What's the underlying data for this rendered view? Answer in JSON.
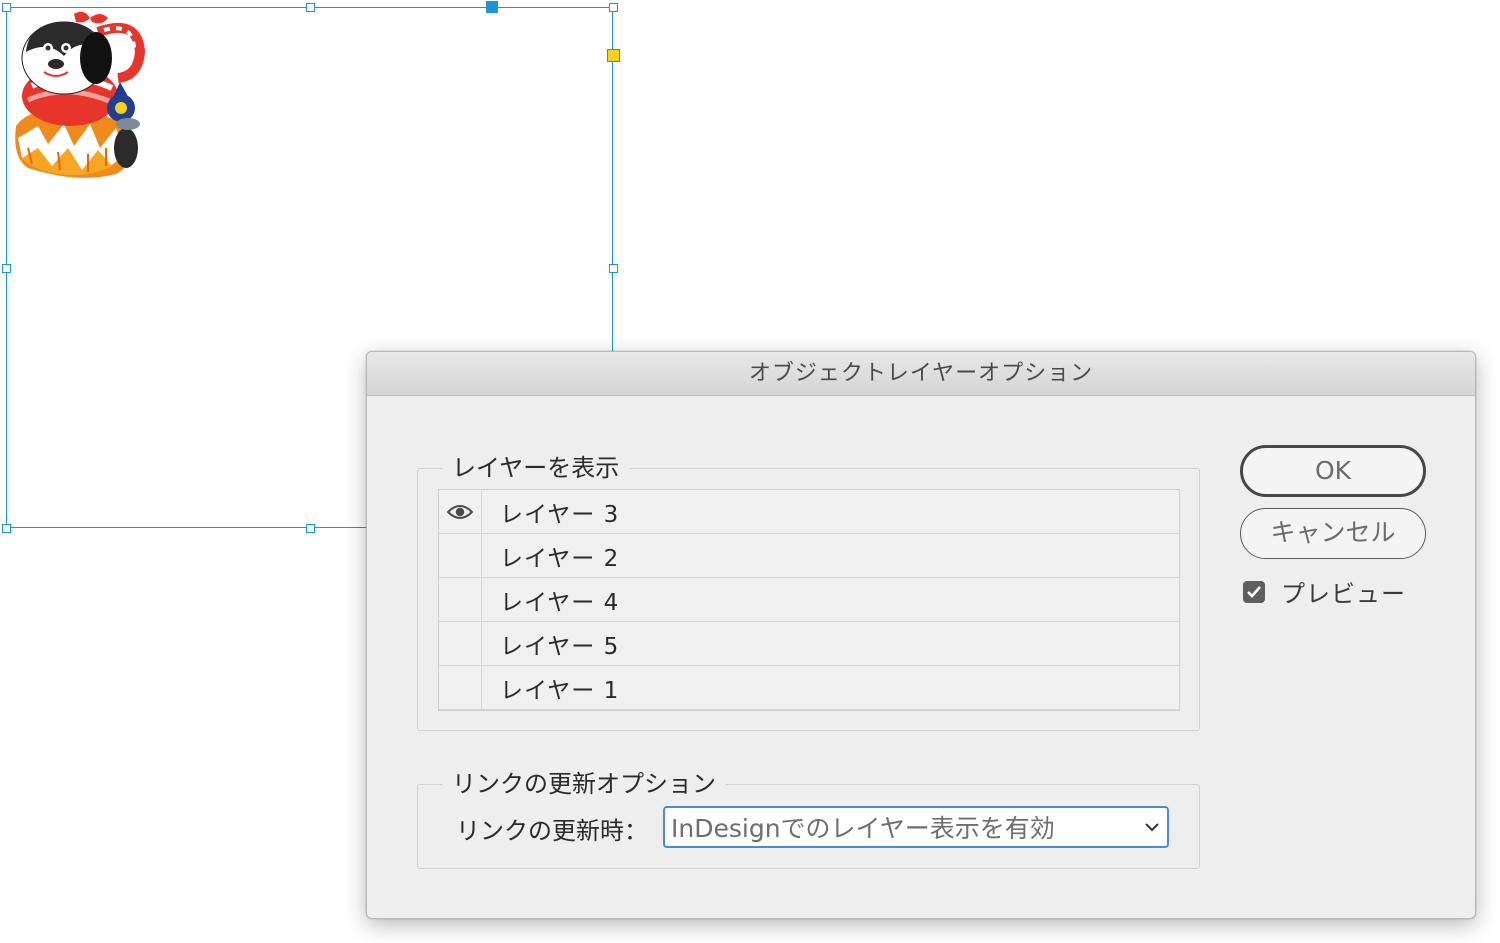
{
  "dialog": {
    "title": "オブジェクトレイヤーオプション",
    "show_layers": {
      "legend": "レイヤーを表示",
      "layers": [
        {
          "name": "レイヤー 3",
          "visible": true
        },
        {
          "name": "レイヤー 2",
          "visible": false
        },
        {
          "name": "レイヤー 4",
          "visible": false
        },
        {
          "name": "レイヤー 5",
          "visible": false
        },
        {
          "name": "レイヤー 1",
          "visible": false
        }
      ]
    },
    "link_update": {
      "legend": "リンクの更新オプション",
      "label": "リンクの更新時：",
      "selected": "InDesignでのレイヤー表示を有効"
    },
    "buttons": {
      "ok": "OK",
      "cancel": "キャンセル"
    },
    "preview": {
      "label": "プレビュー",
      "checked": true
    }
  },
  "colors": {
    "selection": "#1d94d8",
    "anchor": "#f7d117",
    "focus_ring": "#4a8ad6"
  },
  "icons": {
    "visibility": "eye-icon",
    "dropdown": "chevron-down-icon",
    "checkbox": "checkmark-icon"
  }
}
